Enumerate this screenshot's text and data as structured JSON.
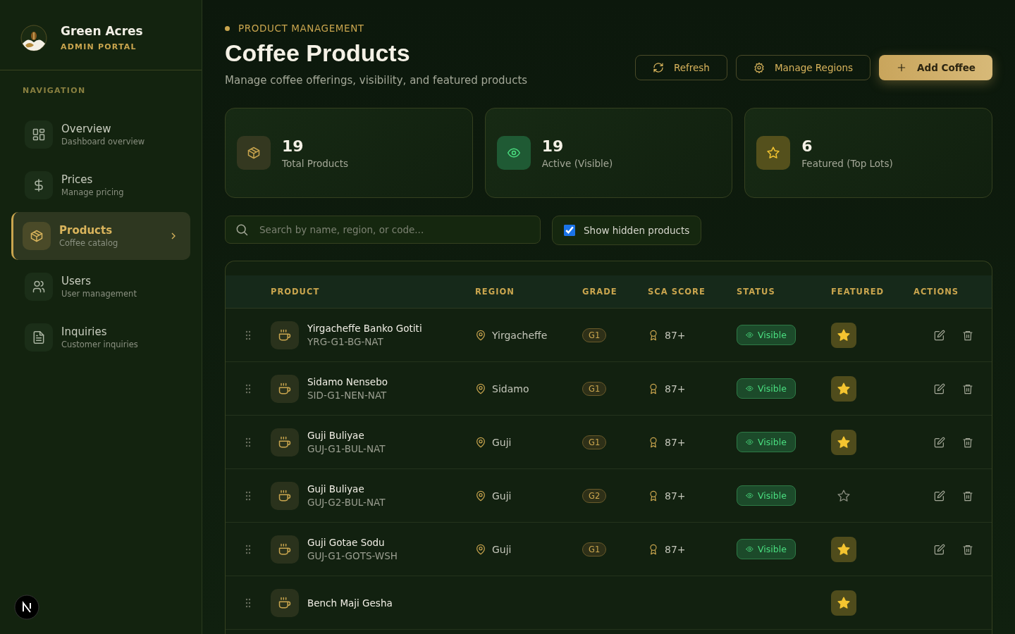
{
  "brand": {
    "name": "Green Acres",
    "subtitle": "ADMIN PORTAL"
  },
  "nav": {
    "heading": "NAVIGATION",
    "items": [
      {
        "label": "Overview",
        "sub": "Dashboard overview",
        "selected": false
      },
      {
        "label": "Prices",
        "sub": "Manage pricing",
        "selected": false
      },
      {
        "label": "Products",
        "sub": "Coffee catalog",
        "selected": true
      },
      {
        "label": "Users",
        "sub": "User management",
        "selected": false
      },
      {
        "label": "Inquiries",
        "sub": "Customer inquiries",
        "selected": false
      }
    ]
  },
  "header": {
    "eyebrow": "PRODUCT MANAGEMENT",
    "title": "Coffee Products",
    "subtitle": "Manage coffee offerings, visibility, and featured products"
  },
  "actions": [
    {
      "label": "Refresh",
      "kind": "outline"
    },
    {
      "label": "Manage Regions",
      "kind": "outline"
    },
    {
      "label": "Add Coffee",
      "kind": "primary"
    }
  ],
  "stats": [
    {
      "value": "19",
      "label": "Total Products"
    },
    {
      "value": "19",
      "label": "Active (Visible)"
    },
    {
      "value": "6",
      "label": "Featured (Top Lots)"
    }
  ],
  "search": {
    "placeholder": "Search by name, region, or code..."
  },
  "show_hidden": {
    "label": "Show hidden products",
    "checked": true
  },
  "table": {
    "columns": [
      "PRODUCT",
      "REGION",
      "GRADE",
      "SCA SCORE",
      "STATUS",
      "FEATURED",
      "ACTIONS"
    ],
    "rows": [
      {
        "name": "Yirgacheffe Banko Gotiti",
        "code": "YRG-G1-BG-NAT",
        "region": "Yirgacheffe",
        "grade": "G1",
        "score": "87+",
        "status": "Visible",
        "featured": true
      },
      {
        "name": "Sidamo Nensebo",
        "code": "SID-G1-NEN-NAT",
        "region": "Sidamo",
        "grade": "G1",
        "score": "87+",
        "status": "Visible",
        "featured": true
      },
      {
        "name": "Guji Buliyae",
        "code": "GUJ-G1-BUL-NAT",
        "region": "Guji",
        "grade": "G1",
        "score": "87+",
        "status": "Visible",
        "featured": true
      },
      {
        "name": "Guji Buliyae",
        "code": "GUJ-G2-BUL-NAT",
        "region": "Guji",
        "grade": "G2",
        "score": "87+",
        "status": "Visible",
        "featured": false
      },
      {
        "name": "Guji Gotae Sodu",
        "code": "GUJ-G1-GOTS-WSH",
        "region": "Guji",
        "grade": "G1",
        "score": "87+",
        "status": "Visible",
        "featured": true
      },
      {
        "name": "Bench Maji Gesha",
        "featured": true
      }
    ]
  }
}
